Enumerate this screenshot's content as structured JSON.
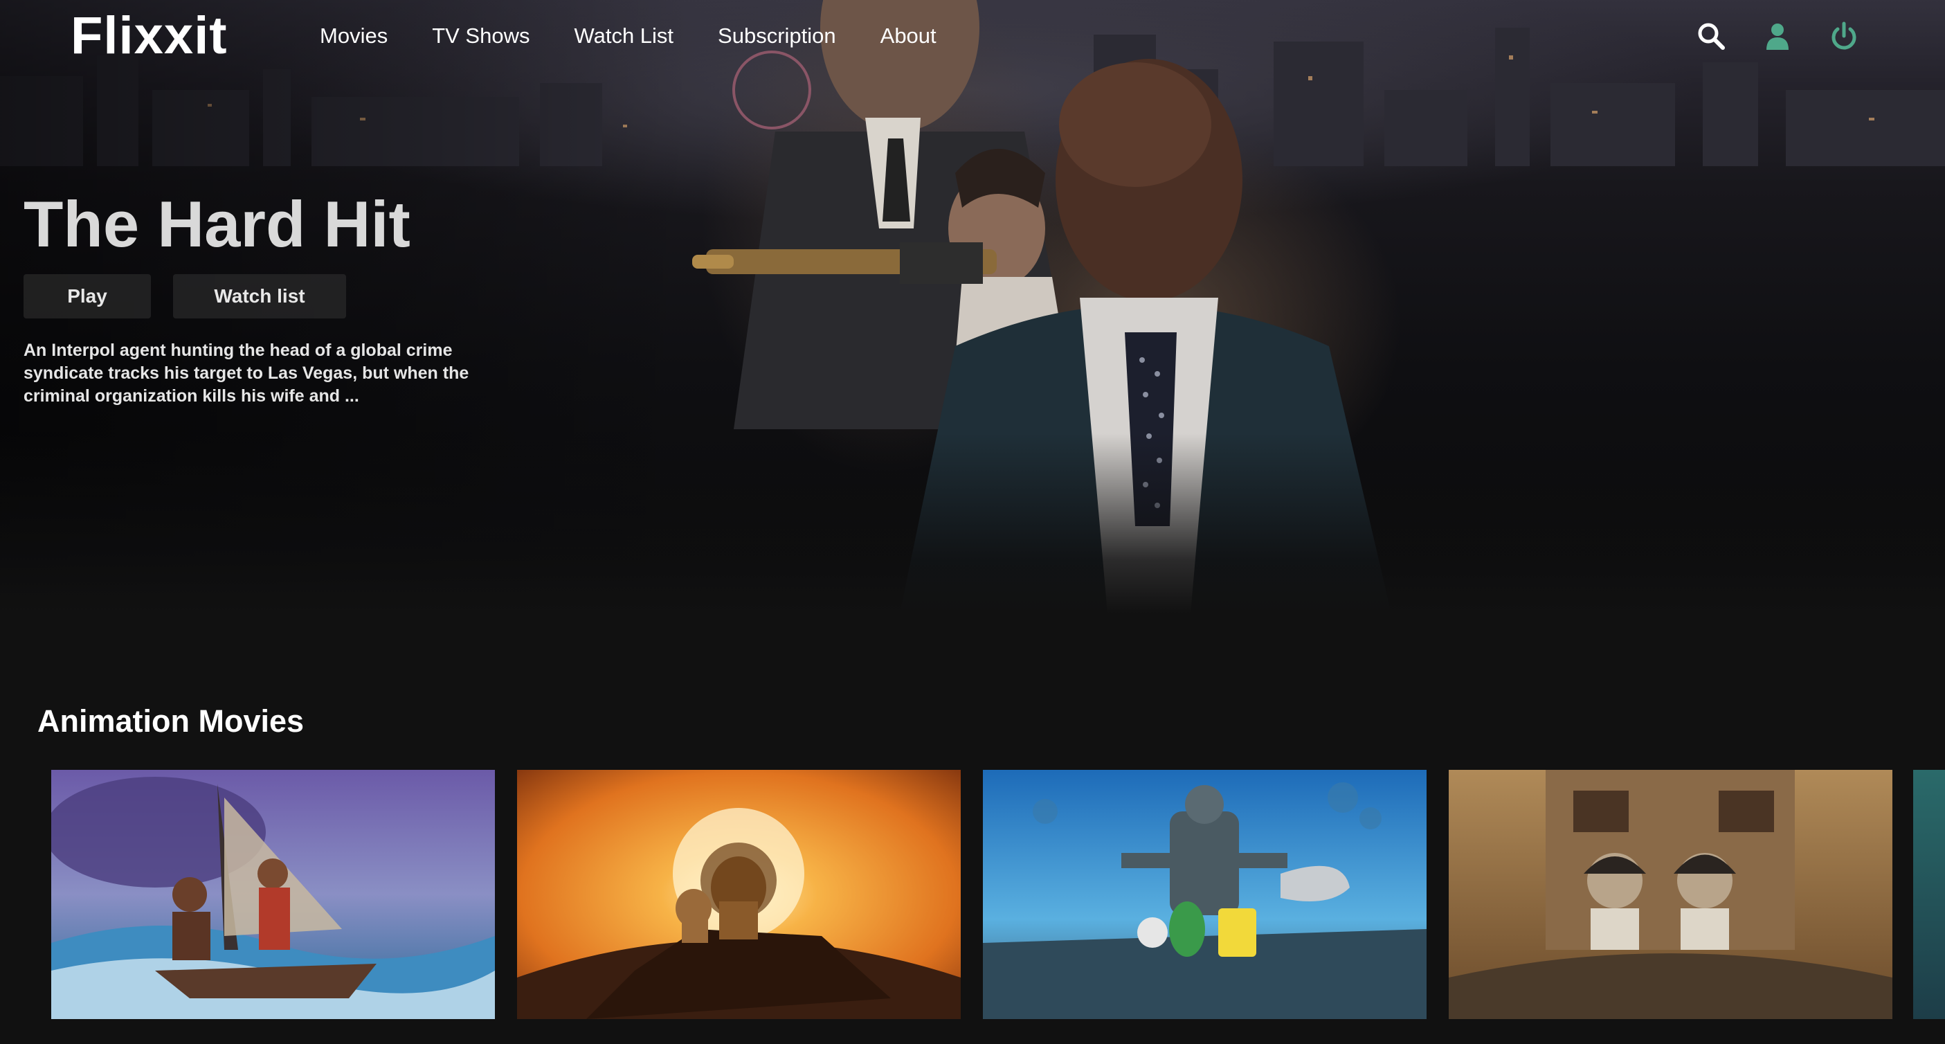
{
  "brand": {
    "name": "Flixxit"
  },
  "nav": {
    "links": [
      "Movies",
      "TV Shows",
      "Watch List",
      "Subscription",
      "About"
    ],
    "icons": [
      "search-icon",
      "user-icon",
      "power-icon"
    ],
    "icon_colors": {
      "search": "#ffffff",
      "user": "#4fa88a",
      "power": "#4fa88a"
    }
  },
  "hero": {
    "title": "The Hard Hit",
    "play_label": "Play",
    "watchlist_label": "Watch list",
    "description": "An Interpol agent hunting the head of a global crime syndicate tracks his target to Las Vegas, but when the criminal organization kills his wife and ..."
  },
  "rows": [
    {
      "title": "Animation Movies",
      "posters": [
        "poster-ocean-voyage",
        "poster-lion-sunset",
        "poster-underwater-robot",
        "poster-rooftop-readers"
      ]
    }
  ]
}
